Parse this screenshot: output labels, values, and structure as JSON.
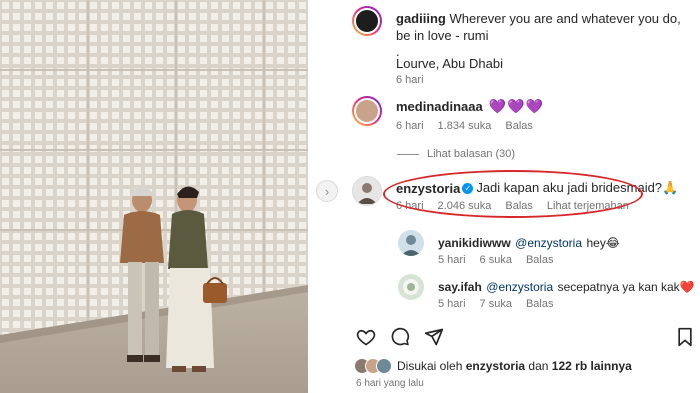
{
  "caption": {
    "username": "gadiiing",
    "text": "Wherever you are and whatever you do, be in love - rumi",
    "dot": ".",
    "location": "Lourve, Abu Dhabi",
    "time": "6 hari"
  },
  "comments": [
    {
      "username": "medinadinaaa",
      "text": "💜💜💜",
      "time": "6 hari",
      "likes": "1.834 suka",
      "reply": "Balas"
    },
    {
      "username": "enzystoria",
      "text": "Jadi kapan aku jadi bridesmaid?🙏",
      "time": "6 hari",
      "likes": "2.046 suka",
      "reply": "Balas",
      "translate": "Lihat terjemahan"
    }
  ],
  "view_replies": "Lihat balasan (30)",
  "replies": [
    {
      "username": "yanikidiwww",
      "mention": "@enzystoria",
      "text": "hey😂",
      "time": "5 hari",
      "likes": "6 suka",
      "reply": "Balas"
    },
    {
      "username": "say.ifah",
      "mention": "@enzystoria",
      "text": "secepatnya ya kan kak❤️",
      "time": "5 hari",
      "likes": "7 suka",
      "reply": "Balas"
    }
  ],
  "liked_by": {
    "prefix": "Disukai oleh",
    "user": "enzystoria",
    "middle": "dan",
    "count": "122 rb lainnya"
  },
  "post_time": "6 hari yang lalu",
  "icons": {
    "like": "heart-icon",
    "comment": "comment-icon",
    "share": "send-icon",
    "save": "bookmark-icon",
    "next": "chevron-right-icon"
  },
  "colors": {
    "verified": "#0095f6",
    "highlight_ellipse": "#d6282b",
    "mention": "#00376b"
  }
}
